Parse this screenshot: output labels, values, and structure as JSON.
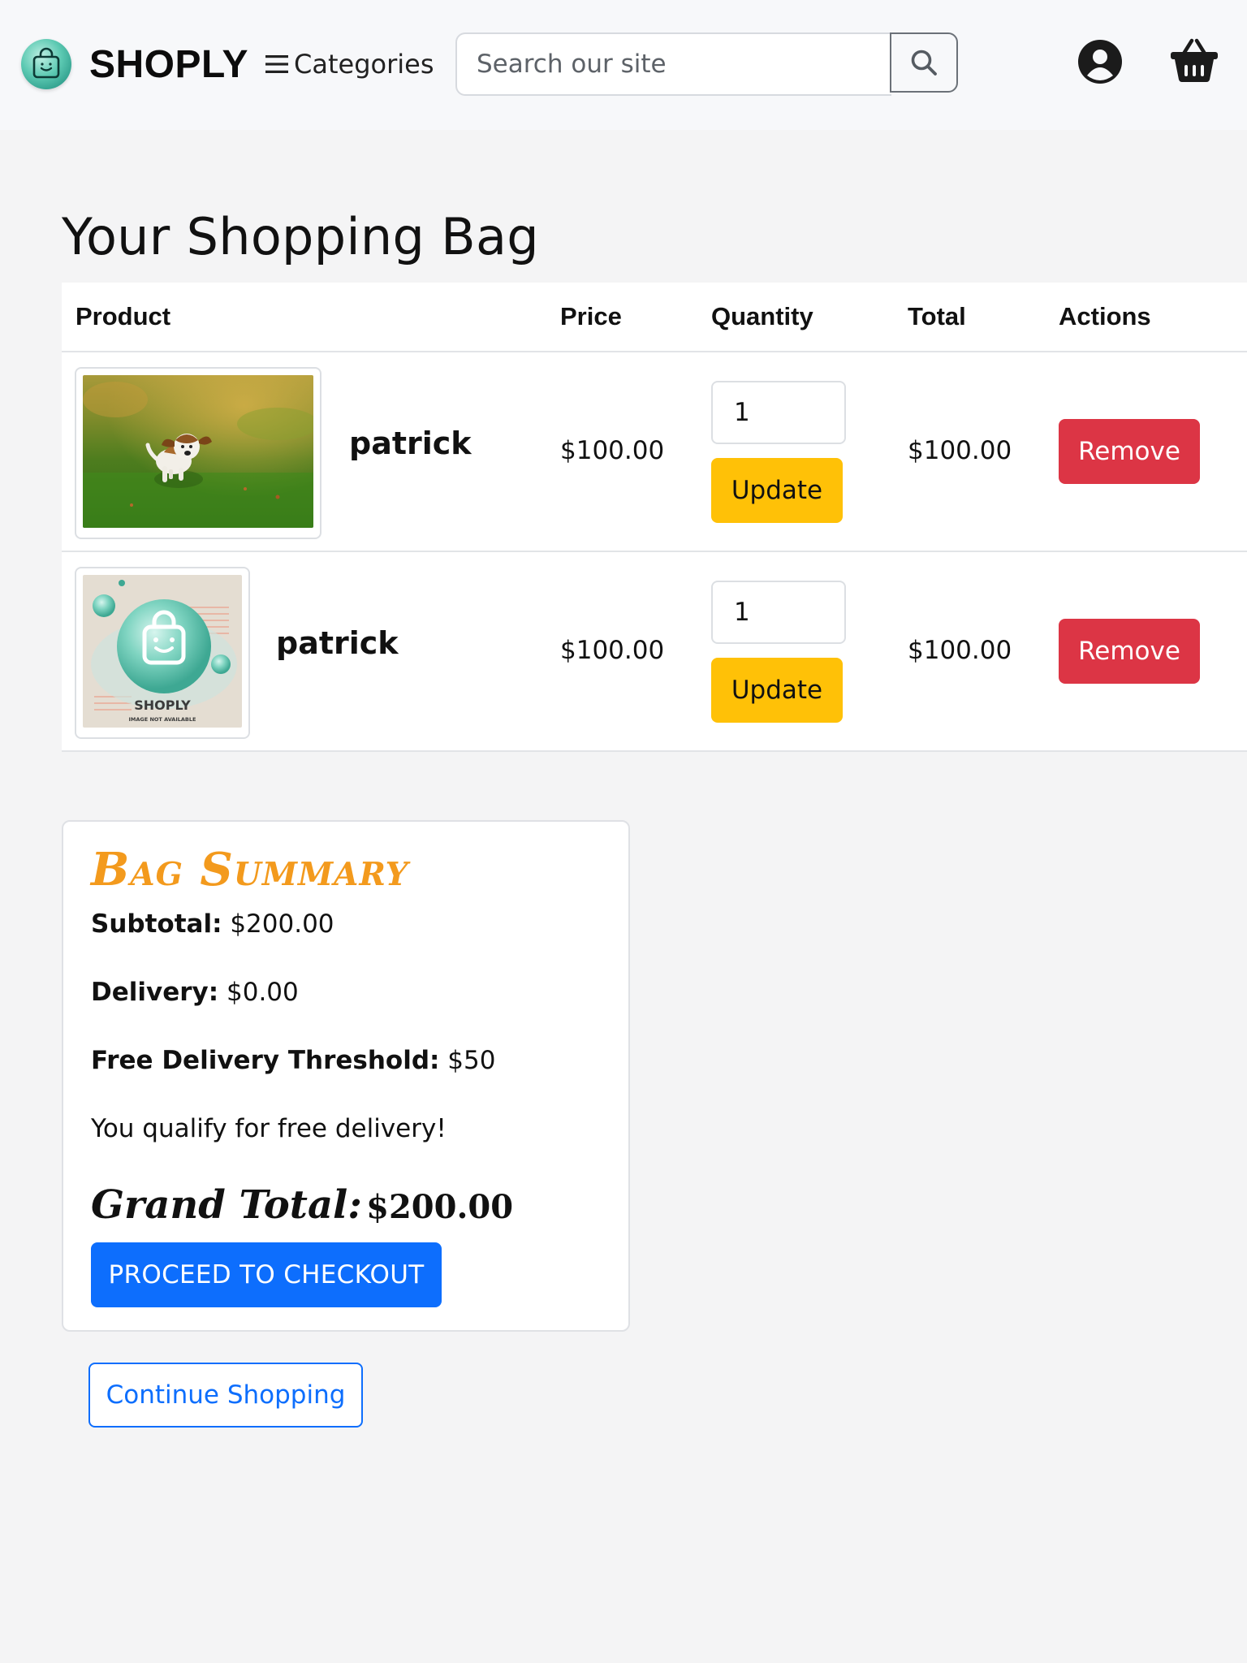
{
  "header": {
    "brand": "SHOPLY",
    "categories_label": "Categories",
    "search_placeholder": "Search our site",
    "icons": {
      "logo": "shopping-bag-logo-icon",
      "menu": "hamburger-icon",
      "search": "search-icon",
      "account": "user-circle-icon",
      "bag": "shopping-basket-icon"
    }
  },
  "page": {
    "title": "Your Shopping Bag"
  },
  "table": {
    "headers": [
      "Product",
      "Price",
      "Quantity",
      "Total",
      "Actions"
    ],
    "rows": [
      {
        "name": "patrick",
        "price": "$100.00",
        "quantity": "1",
        "total": "$100.00",
        "update_label": "Update",
        "remove_label": "Remove",
        "image": "puppy-running-on-grass-photo"
      },
      {
        "name": "patrick",
        "price": "$100.00",
        "quantity": "1",
        "total": "$100.00",
        "update_label": "Update",
        "remove_label": "Remove",
        "image": "shoply-image-not-available-placeholder",
        "placeholder_brand": "SHOPLY",
        "placeholder_caption": "IMAGE NOT AVAILABLE"
      }
    ]
  },
  "summary": {
    "title": "Bag Summary",
    "subtotal_label": "Subtotal:",
    "subtotal_value": "$200.00",
    "delivery_label": "Delivery:",
    "delivery_value": "$0.00",
    "threshold_label": "Free Delivery Threshold:",
    "threshold_value": "$50",
    "free_delivery_msg": "You qualify for free delivery!",
    "grand_total_label": "Grand Total:",
    "grand_total_value": "$200.00",
    "checkout_label": "PROCEED TO CHECKOUT"
  },
  "continue_label": "Continue Shopping",
  "colors": {
    "accent_orange": "#f39a1d",
    "primary_blue": "#0d6efd",
    "update_yellow": "#ffc107",
    "remove_red": "#dc3545",
    "logo_teal": "#5cc9b2"
  }
}
